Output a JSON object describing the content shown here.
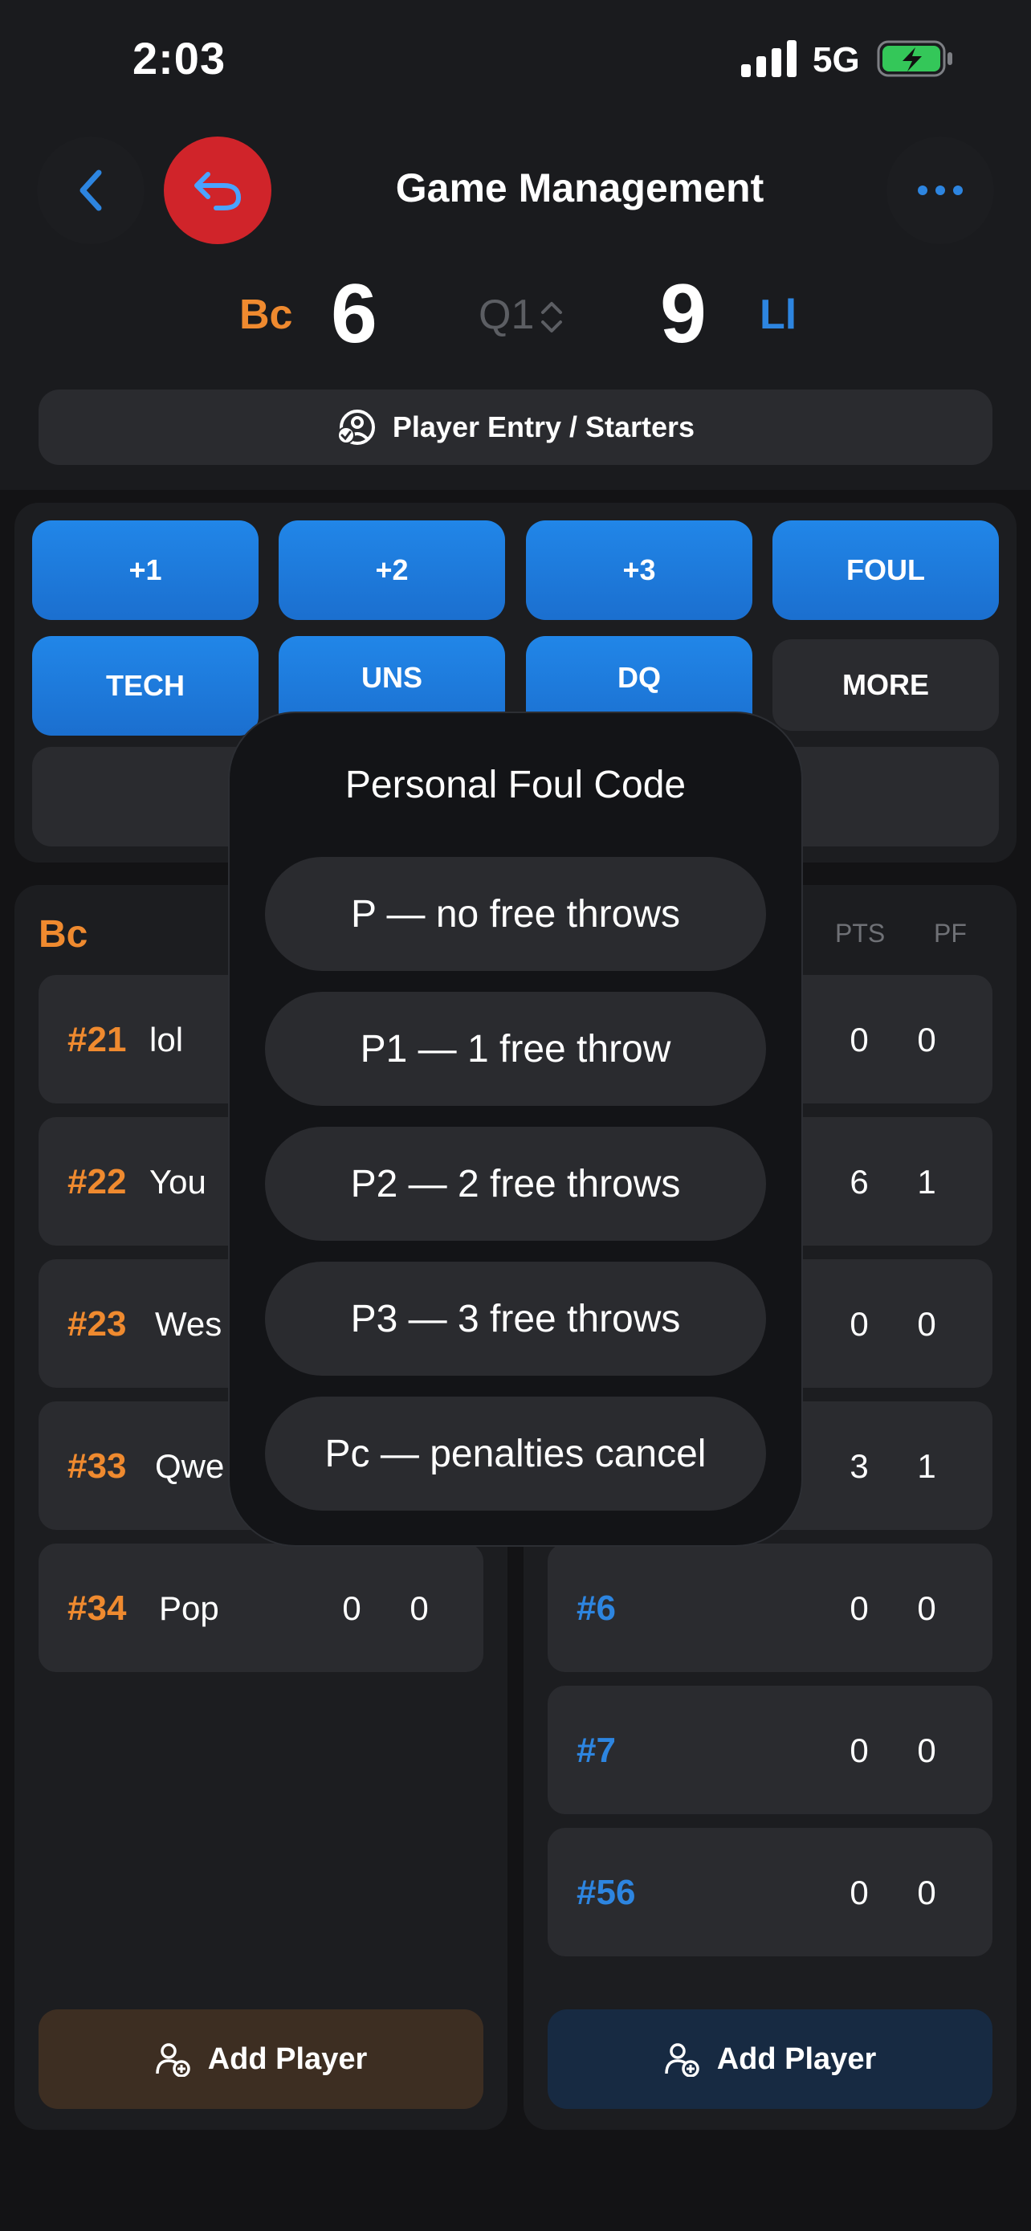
{
  "status": {
    "time": "2:03",
    "network": "5G"
  },
  "header": {
    "title": "Game Management"
  },
  "score": {
    "home_team": "Bc",
    "home_score": "6",
    "period": "Q1",
    "away_score": "9",
    "away_team": "Ll"
  },
  "entry_button": {
    "label": "Player Entry / Starters"
  },
  "actions": {
    "row1": [
      "+1",
      "+2",
      "+3",
      "FOUL"
    ],
    "row2": [
      "TECH",
      "UNS",
      "DQ",
      "MORE"
    ]
  },
  "home_roster": {
    "team": "Bc",
    "players": [
      {
        "num": "#21",
        "name": "lol"
      },
      {
        "num": "#22",
        "name": "You"
      },
      {
        "num": "#23",
        "name": "Wes"
      },
      {
        "num": "#33",
        "name": "Qwe"
      },
      {
        "num": "#34",
        "name": "Pop",
        "pts": "0",
        "pf": "0"
      }
    ],
    "add_label": "Add Player"
  },
  "away_roster": {
    "columns": {
      "pts": "PTS",
      "pf": "PF"
    },
    "players": [
      {
        "num": "",
        "pts": "0",
        "pf": "0"
      },
      {
        "num": "",
        "pts": "6",
        "pf": "1"
      },
      {
        "num": "",
        "pts": "0",
        "pf": "0"
      },
      {
        "num": "",
        "pts": "3",
        "pf": "1"
      },
      {
        "num": "#6",
        "pts": "0",
        "pf": "0"
      },
      {
        "num": "#7",
        "pts": "0",
        "pf": "0"
      },
      {
        "num": "#56",
        "pts": "0",
        "pf": "0"
      }
    ],
    "add_label": "Add Player"
  },
  "modal": {
    "title": "Personal Foul Code",
    "options": [
      "P — no free throws",
      "P1 — 1 free throw",
      "P2 — 2 free throws",
      "P3 — 3 free throws",
      "Pc — penalties cancel"
    ]
  },
  "colors": {
    "home": "#ef8a2f",
    "away": "#2d85e0",
    "undo": "#d0242a",
    "action": "#1f80e3"
  }
}
